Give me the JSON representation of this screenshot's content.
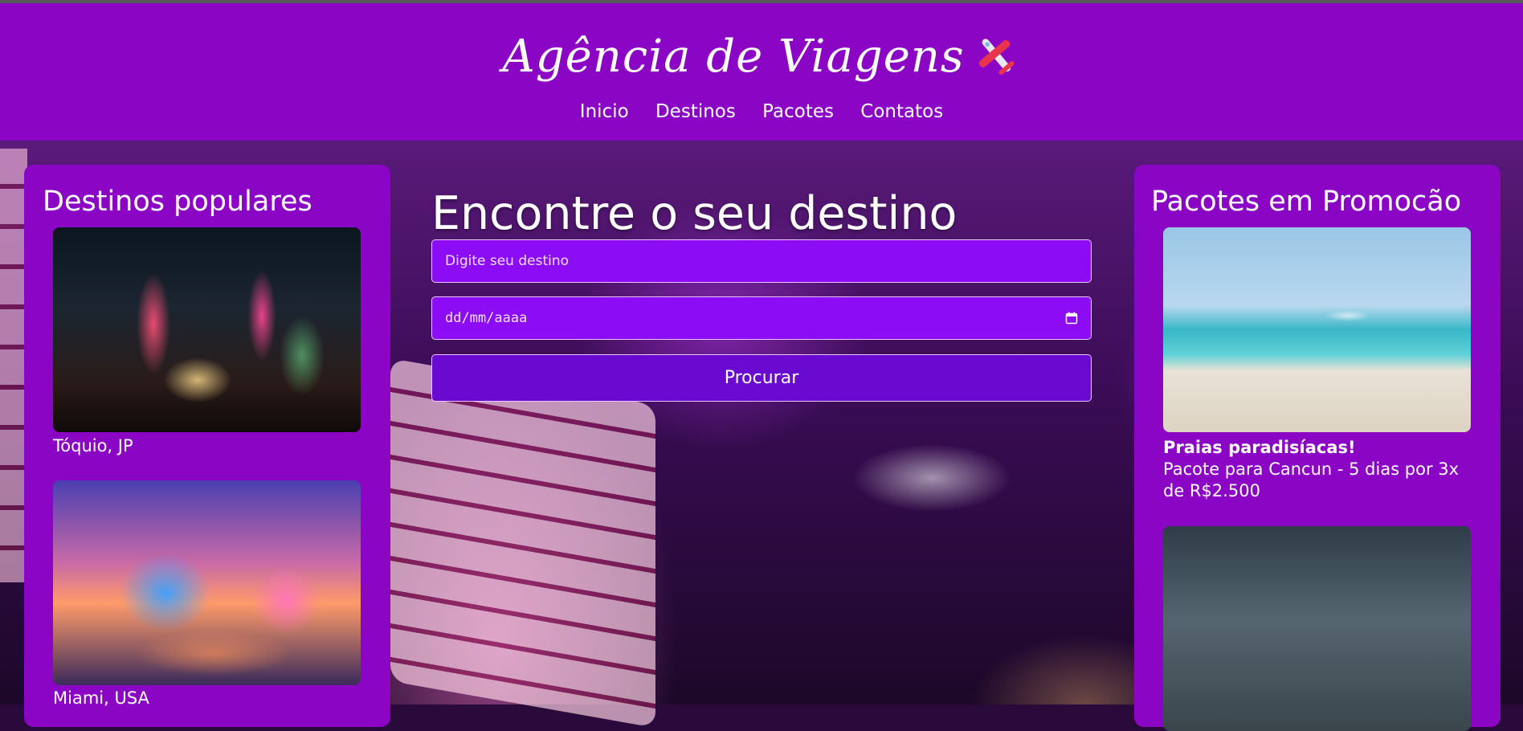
{
  "header": {
    "title": "Agência de Viagens",
    "nav": [
      "Inicio",
      "Destinos",
      "Pacotes",
      "Contatos"
    ]
  },
  "left_panel": {
    "title": "Destinos populares",
    "items": [
      {
        "caption": "Tóquio, JP"
      },
      {
        "caption": "Miami, USA"
      }
    ]
  },
  "search": {
    "title": "Encontre o seu destino",
    "destination_placeholder": "Digite seu destino",
    "date_placeholder": "dd/mm/aaaa",
    "button_label": "Procurar"
  },
  "right_panel": {
    "title": "Pacotes em Promocão",
    "items": [
      {
        "title": "Praias paradisíacas!",
        "description": "Pacote para Cancun - 5 dias por 3x de R$2.500"
      }
    ]
  },
  "colors": {
    "header_bg": "#8a05c4",
    "panel_bg": "#8a05c4",
    "input_bg": "#8b0cf5",
    "button_bg": "#6a0ad0"
  }
}
